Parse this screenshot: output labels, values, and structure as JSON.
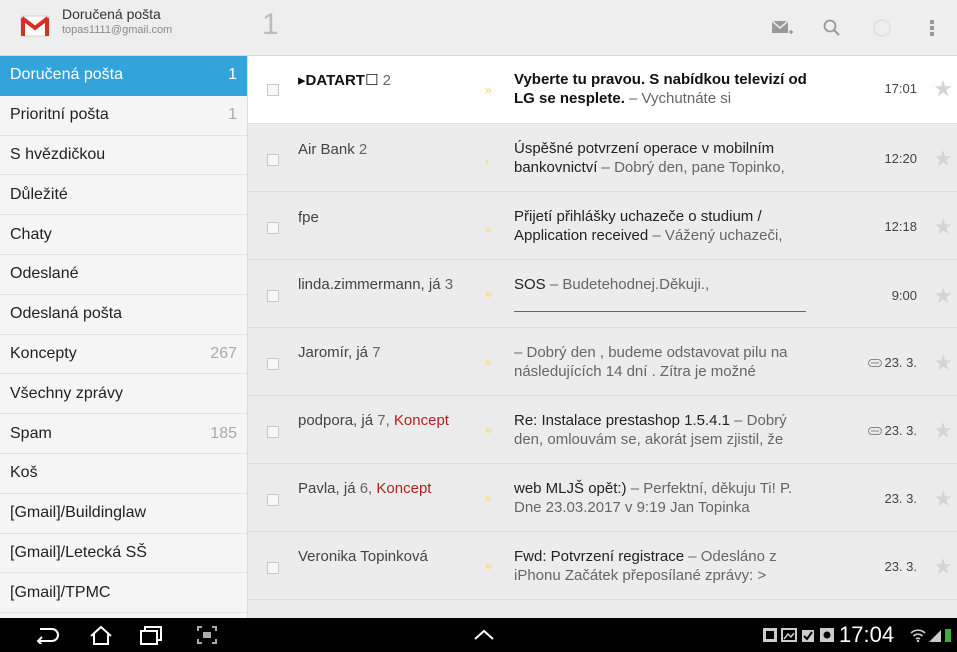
{
  "account": {
    "title": "Doručená pošta",
    "email": "topas1111@gmail.com"
  },
  "topbar": {
    "selected_count": "1",
    "actions": [
      "compose-icon",
      "search-icon",
      "refresh-icon",
      "overflow-menu-icon"
    ]
  },
  "sidebar": {
    "folders": [
      {
        "label": "Doručená pošta",
        "count": "1"
      },
      {
        "label": "Prioritní pošta",
        "count": "1"
      },
      {
        "label": "S hvězdičkou",
        "count": ""
      },
      {
        "label": "Důležité",
        "count": ""
      },
      {
        "label": "Chaty",
        "count": ""
      },
      {
        "label": "Odeslané",
        "count": ""
      },
      {
        "label": "Odeslaná pošta",
        "count": ""
      },
      {
        "label": "Koncepty",
        "count": "267"
      },
      {
        "label": "Všechny zprávy",
        "count": ""
      },
      {
        "label": "Spam",
        "count": "185"
      },
      {
        "label": "Koš",
        "count": ""
      },
      {
        "label": "[Gmail]/Buildinglaw",
        "count": ""
      },
      {
        "label": "[Gmail]/Letecká SŠ",
        "count": ""
      },
      {
        "label": "[Gmail]/TPMC",
        "count": ""
      }
    ]
  },
  "messages": [
    {
      "sender": "▸DATART☐",
      "count": "2",
      "draft": "",
      "subject": "Vyberte tu pravou. S nabídkou televizí od LG se nesplete.",
      "snippet": " – Vychutnáte si",
      "time": "17:01",
      "attachment": false,
      "unread": true
    },
    {
      "sender": "Air Bank",
      "count": "2",
      "draft": "",
      "subject": "Úspěšné potvrzení operace v mobilním bankovnictví",
      "snippet": " – Dobrý den, pane Topinko,",
      "time": "12:20",
      "attachment": false,
      "unread": false
    },
    {
      "sender": "fpe",
      "count": "",
      "draft": "",
      "subject": "Přijetí přihlášky uchazeče o studium / Application received",
      "snippet": " – Vážený uchazeči,",
      "time": "12:18",
      "attachment": false,
      "unread": false
    },
    {
      "sender": "linda.zimmermann, já",
      "count": "3",
      "draft": "",
      "subject": "SOS",
      "snippet": " – Budetehodnej.Děkuji.,",
      "time": "9:00",
      "attachment": false,
      "unread": false
    },
    {
      "sender": "Jaromír, já",
      "count": "7",
      "draft": "",
      "subject": "",
      "snippet": " – Dobrý den , budeme odstavovat pilu na následujících 14 dní . Zítra je možné",
      "time": "23. 3.",
      "attachment": true,
      "unread": false
    },
    {
      "sender": "podpora, já",
      "count": "7,",
      "draft": "Koncept",
      "subject": "Re: Instalace prestashop 1.5.4.1",
      "snippet": " – Dobrý den, omlouvám se, akorát jsem zjistil, že",
      "time": "23. 3.",
      "attachment": true,
      "unread": false
    },
    {
      "sender": "Pavla, já",
      "count": "6,",
      "draft": "Koncept",
      "subject": "web MLJŠ opět:)",
      "snippet": " – Perfektní, děkuju Ti! P. Dne 23.03.2017 v 9:19 Jan Topinka",
      "time": "23. 3.",
      "attachment": false,
      "unread": false
    },
    {
      "sender": "Veronika Topinková",
      "count": "",
      "draft": "",
      "subject": "Fwd: Potvrzení registrace",
      "snippet": " – Odesláno z iPhonu Začátek přeposílané zprávy: >",
      "time": "23. 3.",
      "attachment": false,
      "unread": false
    }
  ],
  "statusbar": {
    "clock": "17:04"
  }
}
